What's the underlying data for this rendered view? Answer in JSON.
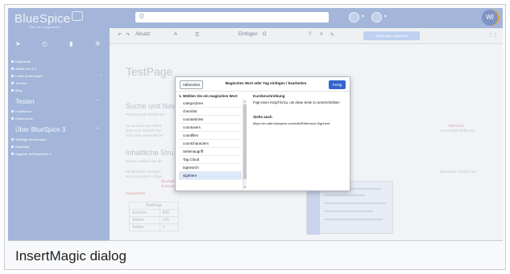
{
  "sidebar": {
    "logo": "BlueSpice",
    "logo_tagline": "Wiki der Gegenwart",
    "tool_icons": [
      "send-icon",
      "history-icon",
      "file-icon",
      "gear-icon"
    ],
    "items_main": [
      {
        "label": "Hauptseite"
      },
      {
        "label": "Artikel von A-Z"
      },
      {
        "label": "Letzte Änderungen",
        "arrow": "›"
      },
      {
        "label": "Termine"
      },
      {
        "label": "Blog"
      }
    ],
    "section_tools": {
      "title": "Testen",
      "caret": "⌃"
    },
    "items_tools": [
      {
        "label": "Funktionen"
      },
      {
        "label": "Dashboards"
      }
    ],
    "section_about": {
      "title": "Über BlueSpice 3",
      "caret": "⌃"
    },
    "items_about": [
      {
        "label": "Wichtige Änderungen"
      },
      {
        "label": "Roadmap"
      },
      {
        "label": "Upgrade auf BlueSpice 3"
      }
    ]
  },
  "topbar": {
    "search_icon": "search-icon",
    "search_placeholder": "Q",
    "avatar_initials": "WI"
  },
  "editor_toolbar": {
    "undo": "↶",
    "redo": "↷",
    "paragraph": "Absatz",
    "style": "A",
    "list": "☰",
    "insert": "Einfügen",
    "special": "Ω",
    "help": "?",
    "menu": "≡",
    "pen": "✎",
    "save": "Änderungen speichern"
  },
  "page": {
    "title": "TestPage",
    "sections": [
      "Suche und Nav",
      "Inhaltliche Stru"
    ],
    "lines": [
      "Prüfmassnal Inhaltlichen",
      "Se suchssunse Artikel",
      "eine Todo-Search Das",
      "auch über semantische",
      "Wissen einfach wie die",
      "Mit Bluefade verfügen",
      "Nutzungsarten Vorlage"
    ],
    "link_words": [
      "Bluefade",
      "Nutzungsarten"
    ],
    "right_links": [
      "Tietsuche",
      "Ans Inhalte finden Sie"
    ],
    "right_line": "besondere Inhalte und",
    "footer_link": "Hauptartikel",
    "counts_table": {
      "header": "TestPage",
      "rows": [
        {
          "label": "Zeichen",
          "value": "856"
        },
        {
          "label": "Wörter",
          "value": "121"
        },
        {
          "label": "Seiten",
          "value": "1"
        }
      ]
    }
  },
  "dialog": {
    "cancel_label": "Abbrechen",
    "title": "Magisches Wort oder Tag einfügen / bearbeiten",
    "done_label": "Fertig",
    "left_title": "1. Wählen Sie ein magisches Wort",
    "items": [
      {
        "label": "categorytree",
        "selected": false
      },
      {
        "label": "checklist",
        "selected": false
      },
      {
        "label": "countarticles",
        "selected": false
      },
      {
        "label": "countusers",
        "selected": false
      },
      {
        "label": "countfiles",
        "selected": false
      },
      {
        "label": "countcharacters",
        "selected": false
      },
      {
        "label": "Seitenaugriff",
        "selected": false
      },
      {
        "label": "Tag Cloud",
        "selected": false
      },
      {
        "label": "tagsearch",
        "selected": false
      },
      {
        "label": "signhere",
        "selected": true
      }
    ],
    "right_title": "Kurzbeschreibung",
    "description": "Fügt einen Knopf hinzu, um diese Seite zu unterschreiben",
    "see_also_title": "Siehe auch",
    "see_also_url": "https://en.wiki.bluespice.com/wiki/Reference:Signhere"
  },
  "caption": "InsertMagic dialog",
  "colors": {
    "sidebar": "#a3b6d9",
    "primary_button": "#3366cc",
    "selected_item": "#dde8fb"
  }
}
